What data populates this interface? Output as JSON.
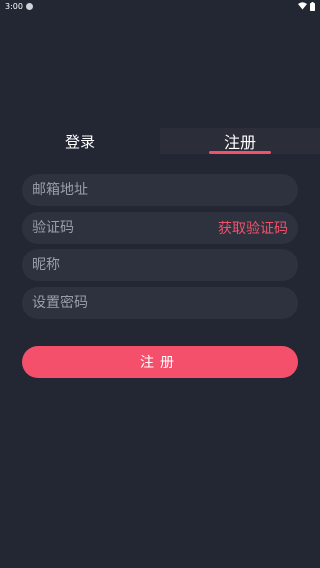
{
  "status_bar": {
    "time": "3:00",
    "icons": [
      "notification-dot-icon",
      "wifi-icon",
      "battery-icon"
    ]
  },
  "tabs": [
    {
      "label": "登录",
      "active": false
    },
    {
      "label": "注册",
      "active": true
    }
  ],
  "form": {
    "email_placeholder": "邮箱地址",
    "code_placeholder": "验证码",
    "get_code_label": "获取验证码",
    "nickname_placeholder": "昵称",
    "password_placeholder": "设置密码",
    "submit_label": "注册"
  },
  "colors": {
    "background": "#232733",
    "field_background": "#2e323e",
    "accent": "#f4506c",
    "placeholder": "#9a9eaa"
  }
}
